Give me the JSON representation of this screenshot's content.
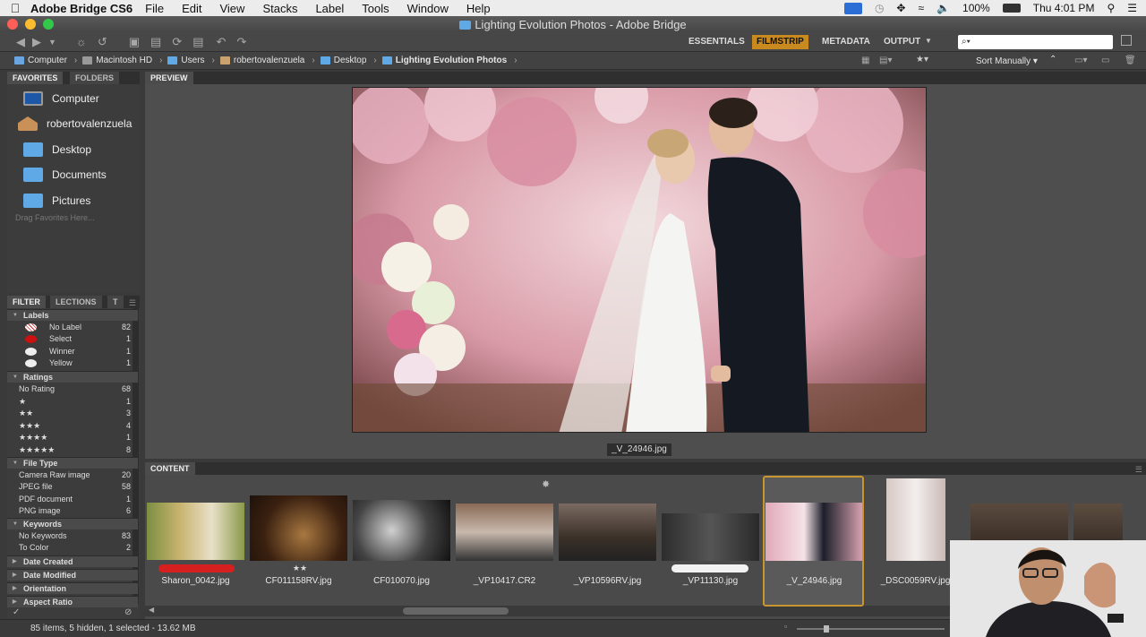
{
  "menubar": {
    "app": "Adobe Bridge CS6",
    "items": [
      "File",
      "Edit",
      "View",
      "Stacks",
      "Label",
      "Tools",
      "Window",
      "Help"
    ],
    "battery": "100%",
    "clock": "Thu 4:01 PM"
  },
  "window": {
    "title": "Lighting Evolution Photos - Adobe Bridge"
  },
  "workspaces": [
    "ESSENTIALS",
    "FILMSTRIP",
    "METADATA",
    "OUTPUT"
  ],
  "toolbar": {
    "search_placeholder": "⌕▾"
  },
  "path": [
    "Computer",
    "Macintosh HD",
    "Users",
    "robertovalenzuela",
    "Desktop",
    "Lighting Evolution Photos"
  ],
  "viewbar": {
    "sort": "Sort Manually"
  },
  "favorites": {
    "tabs": [
      "FAVORITES",
      "FOLDERS"
    ],
    "items": [
      "Computer",
      "robertovalenzuela",
      "Desktop",
      "Documents",
      "Pictures"
    ],
    "hint": "Drag Favorites Here..."
  },
  "filter": {
    "tabs": [
      "FILTER",
      "LECTIONS",
      "T"
    ],
    "labels_title": "Labels",
    "labels": [
      {
        "name": "No Label",
        "count": "82"
      },
      {
        "name": "Select",
        "count": "1"
      },
      {
        "name": "Winner",
        "count": "1"
      },
      {
        "name": "Yellow",
        "count": "1"
      }
    ],
    "ratings_title": "Ratings",
    "ratings": [
      {
        "name": "No Rating",
        "count": "68"
      },
      {
        "name": "★",
        "count": "1"
      },
      {
        "name": "★★",
        "count": "3"
      },
      {
        "name": "★★★",
        "count": "4"
      },
      {
        "name": "★★★★",
        "count": "1"
      },
      {
        "name": "★★★★★",
        "count": "8"
      }
    ],
    "filetype_title": "File Type",
    "filetypes": [
      {
        "name": "Camera Raw image",
        "count": "20"
      },
      {
        "name": "JPEG file",
        "count": "58"
      },
      {
        "name": "PDF document",
        "count": "1"
      },
      {
        "name": "PNG image",
        "count": "6"
      }
    ],
    "keywords_title": "Keywords",
    "keywords": [
      {
        "name": "No Keywords",
        "count": "83"
      },
      {
        "name": "To Color",
        "count": "2"
      }
    ],
    "collapsed": [
      "Date Created",
      "Date Modified",
      "Orientation",
      "Aspect Ratio"
    ]
  },
  "preview": {
    "tab": "PREVIEW",
    "filename": "_V_24946.jpg"
  },
  "content": {
    "tab": "CONTENT",
    "files": [
      "Sharon_0042.jpg",
      "CF011158RV.jpg",
      "CF010070.jpg",
      "_VP10417.CR2",
      "_VP10596RV.jpg",
      "_VP11130.jpg",
      "_V_24946.jpg",
      "_DSC0059RV.jpg"
    ],
    "second_rating": "★★"
  },
  "status": {
    "text": "85 items, 5 hidden, 1 selected - 13.62 MB"
  },
  "colors": {
    "accent": "#c88a1e",
    "select_label": "#d62020",
    "panel": "#3c3c3c"
  }
}
